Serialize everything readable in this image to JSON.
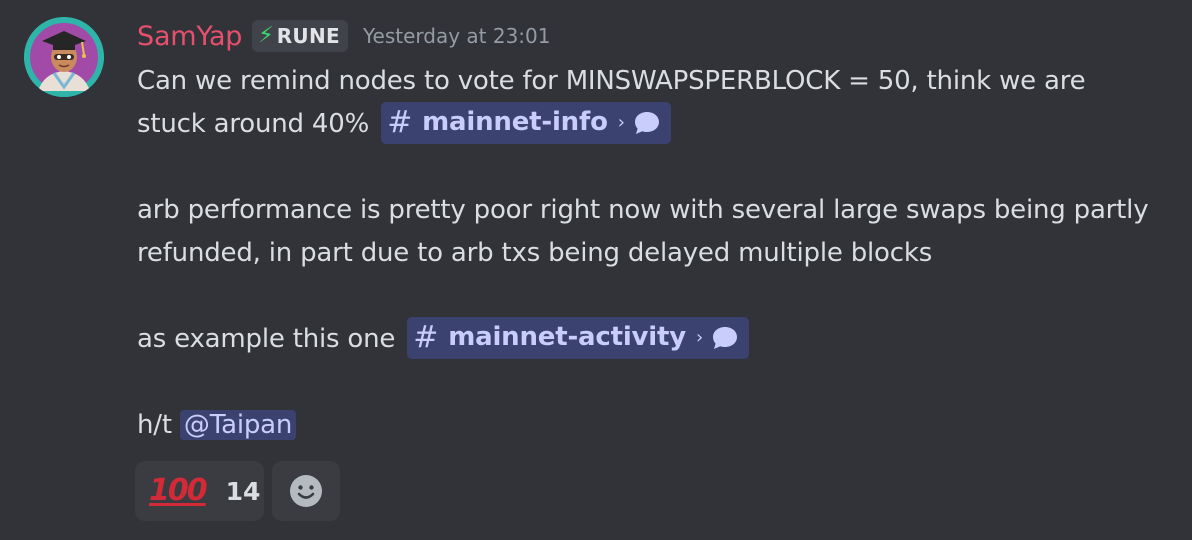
{
  "message": {
    "author": "SamYap",
    "author_color": "#e6506d",
    "role_tag": {
      "icon": "lightning-bolt-icon",
      "label": "RUNE",
      "icon_glyph": "⚡"
    },
    "timestamp": "Yesterday at 23:01",
    "paragraph1": {
      "text": "Can we remind nodes to vote for MINSWAPSPERBLOCK = 50, think we are stuck around 40%",
      "channel": "mainnet-info"
    },
    "paragraph2": {
      "text": "arb performance is pretty poor right now with several large swaps being partly refunded, in part due to arb txs being delayed multiple blocks"
    },
    "paragraph3": {
      "text": "as example this one",
      "channel": "mainnet-activity"
    },
    "paragraph4": {
      "text": "h/t",
      "mention": "@Taipan"
    }
  },
  "channel_chip": {
    "hash": "#",
    "chevron": "›"
  },
  "reactions": [
    {
      "emoji": "hundred-points-icon",
      "emoji_glyph": "100",
      "count": "14"
    }
  ],
  "add_reaction": {
    "icon": "smiley-face-icon"
  },
  "colors": {
    "background": "#313338",
    "text": "#dbdee1",
    "muted": "#949ba4",
    "chip_bg": "#3c4270",
    "chip_text": "#c9cdfb",
    "tag_bolt": "#3ed96e"
  }
}
